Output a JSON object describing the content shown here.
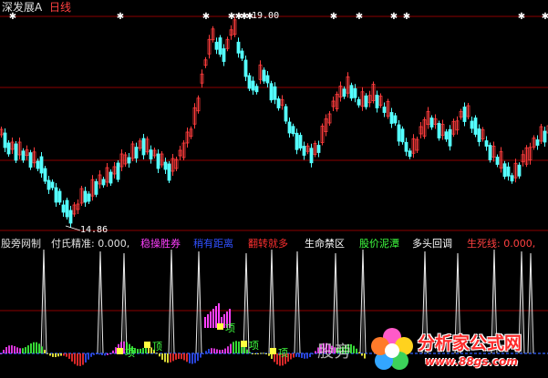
{
  "header": {
    "stock_name": "深发展A",
    "period": "日线"
  },
  "price_labels": {
    "high": "19.00",
    "low": "14.86"
  },
  "indicator_bar": {
    "items": [
      {
        "text": "股旁网制",
        "color": "#e0e0e0"
      },
      {
        "text": "付氏精准: 0.000,",
        "color": "#e0e0e0"
      },
      {
        "text": "稳操胜券",
        "color": "#ff40ff"
      },
      {
        "text": "稍有距离",
        "color": "#3050ff"
      },
      {
        "text": "翻转就多",
        "color": "#ff3030"
      },
      {
        "text": "生命禁区",
        "color": "#ffffff"
      },
      {
        "text": "股价泥潭",
        "color": "#40ff40"
      },
      {
        "text": "多头回调",
        "color": "#ffffff"
      },
      {
        "text": "生死线: 0.000,",
        "color": "#ff4040"
      }
    ]
  },
  "signal_labels": [
    "项",
    "顶",
    "项",
    "项",
    "项"
  ],
  "watermark": "股旁",
  "logo": {
    "brand": "分析家公式网",
    "url": "www.88gs.com"
  },
  "colors": {
    "up": "#ff3c3c",
    "down": "#54ffff",
    "grid": "#8b0000",
    "spike": "#e8e8e8",
    "star": "#ffffff"
  }
}
